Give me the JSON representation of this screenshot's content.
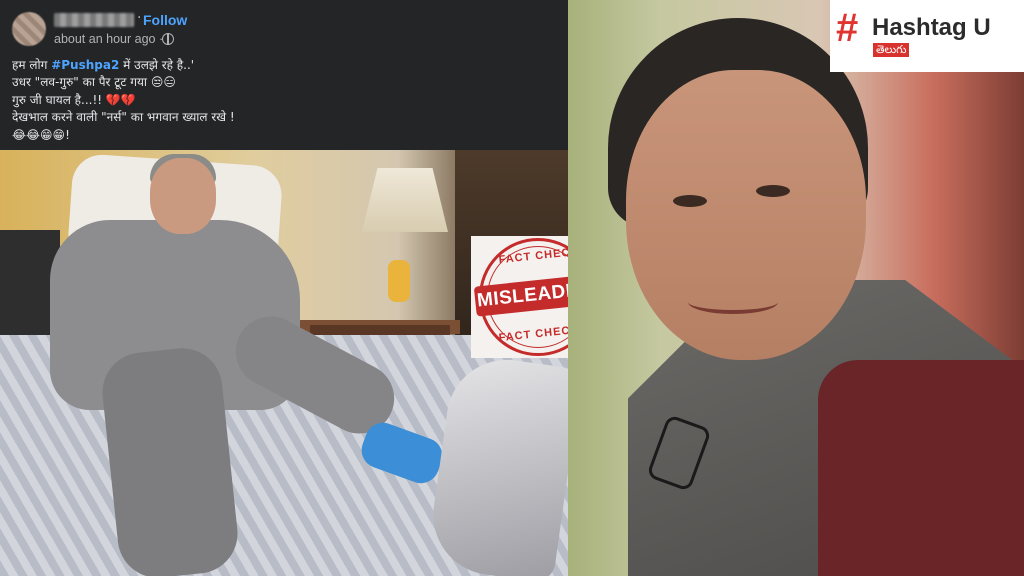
{
  "post": {
    "follow_label": "Follow",
    "separator": "·",
    "timestamp": "about an hour ago",
    "meta_separator": "·",
    "lines": [
      {
        "before": "हम लोग ",
        "hashtag": "#Pushpa2",
        "after": "  में उलझे रहे है..'"
      },
      {
        "text": "उधर \"लव-गुरु\" का पैर टूट गया 😒😑"
      },
      {
        "text": "गुरु जी घायल है...!! 💔💔"
      },
      {
        "text": "देखभाल करने वाली \"नर्स\" का भगवान ख्याल रखे !"
      },
      {
        "text": "😂😂😁😁!"
      }
    ]
  },
  "stamp": {
    "top_text": "FACT CHECK",
    "label": "MISLEADING",
    "bottom_text": "FACT CHECK",
    "color": "#c42b2b"
  },
  "logo": {
    "hash": "#",
    "text": "Hashtag U",
    "sub": "తెలుగు",
    "accent": "#e0342e"
  }
}
